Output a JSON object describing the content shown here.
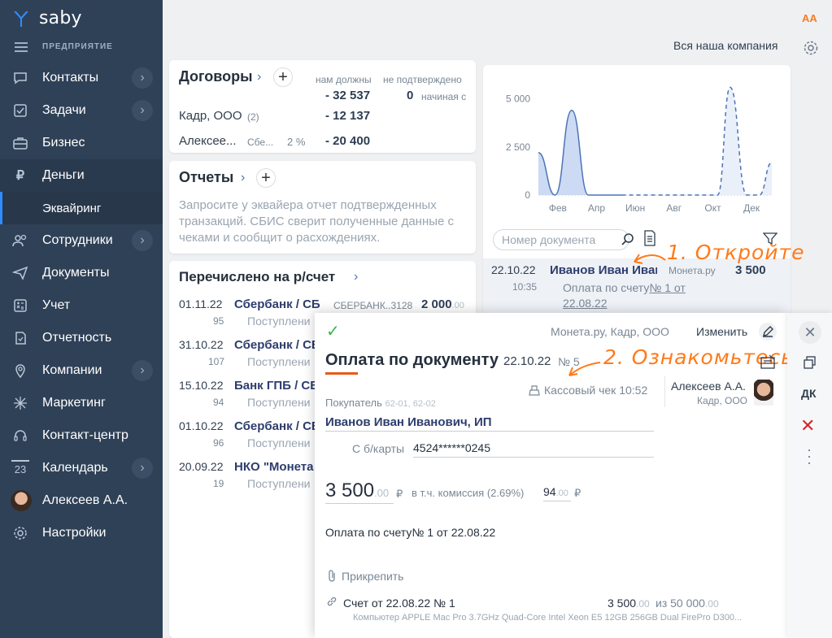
{
  "app": {
    "logo_text": "saby",
    "org": "ПРЕДПРИЯТИЕ"
  },
  "sidebar": {
    "items": [
      {
        "label": "Контакты",
        "icon": "chat-icon",
        "has_chevron": true
      },
      {
        "label": "Задачи",
        "icon": "tasks-icon",
        "has_chevron": true
      },
      {
        "label": "Бизнес",
        "icon": "briefcase-icon",
        "has_chevron": false
      },
      {
        "label": "Деньги",
        "icon": "ruble-icon",
        "has_chevron": false
      },
      {
        "label": "Эквайринг",
        "icon": "",
        "has_chevron": false
      },
      {
        "label": "Сотрудники",
        "icon": "people-icon",
        "has_chevron": true
      },
      {
        "label": "Документы",
        "icon": "paper-plane-icon",
        "has_chevron": false
      },
      {
        "label": "Учет",
        "icon": "calculator-icon",
        "has_chevron": false
      },
      {
        "label": "Отчетность",
        "icon": "report-icon",
        "has_chevron": false
      },
      {
        "label": "Компании",
        "icon": "location-icon",
        "has_chevron": true
      },
      {
        "label": "Маркетинг",
        "icon": "spark-icon",
        "has_chevron": false
      },
      {
        "label": "Контакт-центр",
        "icon": "headset-icon",
        "has_chevron": false
      },
      {
        "label": "Календарь",
        "icon": "calendar-icon",
        "has_chevron": true,
        "icon_text": "23"
      },
      {
        "label": "Алексеев А.А.",
        "icon": "avatar",
        "has_chevron": false
      },
      {
        "label": "Настройки",
        "icon": "gear-icon",
        "has_chevron": false
      }
    ]
  },
  "topbar": {
    "font_toggle": "AA",
    "company": "Вся наша компания"
  },
  "contracts": {
    "title": "Договоры",
    "col_owed": "нам должны",
    "col_unconfirmed": "не подтверждено",
    "total_owed": "- 32 537",
    "total_unconfirmed": "0",
    "starting": "начиная с",
    "rows": [
      {
        "name": "Кадр, ООО",
        "count": "(2)",
        "extra": "",
        "pct": "",
        "value": "- 12 137"
      },
      {
        "name": "Алексее...",
        "count": "",
        "extra": "Сбе...",
        "pct": "2 %",
        "value": "- 20 400"
      }
    ]
  },
  "reports": {
    "title": "Отчеты",
    "text": "Запросите у эквайера отчет подтвержденных транзакций. СБИС сверит полученные данные с чеками и сообщит о расхождениях."
  },
  "transfers": {
    "title": "Перечислено на р/счет",
    "rows": [
      {
        "date": "01.11.22",
        "num": "95",
        "name": "Сбербанк / СБ",
        "desc": "Поступлени",
        "acc": "СБЕРБАНК..3128",
        "sum": "2 000",
        "cents": ".00"
      },
      {
        "date": "31.10.22",
        "num": "107",
        "name": "Сбербанк / СБ",
        "desc": "Поступлени",
        "acc": "",
        "sum": "",
        "cents": ""
      },
      {
        "date": "15.10.22",
        "num": "94",
        "name": "Банк ГПБ / СБ",
        "desc": "Поступлени",
        "acc": "",
        "sum": "",
        "cents": ""
      },
      {
        "date": "01.10.22",
        "num": "96",
        "name": "Сбербанк / СБ",
        "desc": "Поступлени",
        "acc": "",
        "sum": "",
        "cents": ""
      },
      {
        "date": "20.09.22",
        "num": "19",
        "name": "НКО \"Монета",
        "desc": "Поступлени",
        "acc": "",
        "sum": "",
        "cents": ""
      }
    ]
  },
  "chart_data": {
    "type": "area",
    "categories": [
      "Фев",
      "Апр",
      "Июн",
      "Авг",
      "Окт",
      "Дек"
    ],
    "y_ticks": [
      "5 000",
      "2 500",
      "0"
    ],
    "ylim": [
      0,
      5700
    ],
    "series": [
      {
        "style": "solid",
        "x": [
          0,
          0.8,
          1.6,
          2.4,
          3.2,
          4.0
        ],
        "values": [
          2200,
          0,
          4400,
          0,
          0,
          0
        ]
      },
      {
        "style": "dashed",
        "x": [
          4.0,
          4.9,
          5.5,
          6.4,
          7.0,
          7.6,
          8.2,
          8.6,
          9.2,
          10.0,
          10.6,
          11.2
        ],
        "values": [
          0,
          0,
          0,
          0,
          0,
          0,
          0,
          0,
          5600,
          0,
          0,
          1700
        ]
      }
    ]
  },
  "list": {
    "search_placeholder": "Номер документа",
    "row": {
      "date": "22.10.22",
      "time": "10:35",
      "name": "Иванов Иван Иван",
      "source": "Монета.ру",
      "sum": "3 500",
      "desc": "Оплата по счету",
      "link": "№ 1 от 22.08.22"
    }
  },
  "annotations": {
    "step1": "1. Откройте",
    "step2": "2. Ознакомьтесь"
  },
  "dialog": {
    "source": "Монета.ру, Кадр, ООО",
    "edit": "Изменить",
    "title": "Оплата по документу",
    "date": "22.10.22",
    "num": "№ 5",
    "receipt": "Кассовый чек 10:52",
    "employee": "Алексеев А.А.",
    "employee_org": "Кадр, ООО",
    "buyer_label": "Покупатель",
    "buyer_codes": "62-01, 62-02",
    "buyer": "Иванов Иван Иванович, ИП",
    "card_label": "С б/карты",
    "card": "4524******0245",
    "amount": "3 500",
    "amount_cents": ".00",
    "currency": "₽",
    "fee_label": "в т.ч. комиссия (2.69%)",
    "fee": "94",
    "fee_cents": ".00",
    "purpose": "Оплата по счету№ 1 от 22.08.22",
    "attach": "Прикрепить",
    "invoice": "Счет от 22.08.22 № 1",
    "invoice_sum": "3 500",
    "invoice_cents": ".00",
    "invoice_of": "из 50 000",
    "invoice_of_cents": ".00",
    "invoice_desc": "Компьютер APPLE Mac Pro 3.7GHz Quad-Core Intel Xeon E5 12GB 256GB Dual FirePro D300..."
  },
  "side_tools": {
    "dk": "ДК"
  },
  "colors": {
    "sidebar": "#2f4157",
    "accent": "#ff7a1a",
    "link": "#2d3d6d",
    "chart": "#4c74b5"
  }
}
